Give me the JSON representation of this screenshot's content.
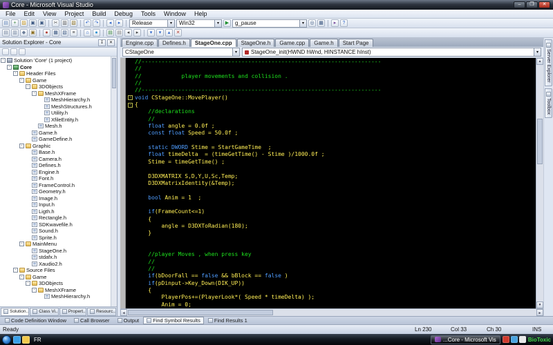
{
  "window": {
    "title": "Core - Microsoft Visual Studio",
    "buttons": {
      "minimize": "–",
      "maximize": "❐",
      "close": "✕"
    }
  },
  "glyphs": {
    "chevron": "▾",
    "up": "▲",
    "down": "▼",
    "left": "◄",
    "right": "►",
    "pin": "↧",
    "close_small": "✕"
  },
  "colors": {
    "comment": "#1ee11e",
    "keyword": "#4f9dff",
    "code_text": "#ffee55",
    "editor_bg": "#000000",
    "tray_green": "#46d94a"
  },
  "menu_bar": {
    "items": [
      "File",
      "Edit",
      "View",
      "Project",
      "Build",
      "Debug",
      "Tools",
      "Window",
      "Help"
    ]
  },
  "toolbar_main": {
    "icons_left": [
      {
        "name": "new-project-icon",
        "glyph": "▤",
        "color": "#5b7fb5"
      },
      {
        "name": "add-item-icon",
        "glyph": "+",
        "color": "#2e7d32"
      },
      {
        "name": "open-file-icon",
        "glyph": "▨",
        "color": "#c9971f"
      },
      {
        "name": "save-icon",
        "glyph": "▣",
        "color": "#35527e"
      },
      {
        "name": "save-all-icon",
        "glyph": "▣",
        "color": "#35527e",
        "sep": true
      },
      {
        "name": "cut-icon",
        "glyph": "✂",
        "color": "#555555"
      },
      {
        "name": "copy-icon",
        "glyph": "▥",
        "color": "#555555"
      },
      {
        "name": "paste-icon",
        "glyph": "▧",
        "color": "#8a6d1d",
        "sep": true
      },
      {
        "name": "undo-icon",
        "glyph": "↶",
        "color": "#2a62c9"
      },
      {
        "name": "redo-icon",
        "glyph": "↷",
        "color": "#2a62c9",
        "sep": true
      },
      {
        "name": "navigate-backward-icon",
        "glyph": "◂",
        "color": "#2a62c9"
      },
      {
        "name": "navigate-forward-icon",
        "glyph": "▸",
        "color": "#2a62c9",
        "sep": true
      }
    ],
    "config_combo": {
      "value": "Release"
    },
    "platform_combo": {
      "value": "Win32"
    },
    "start_debug_icon": {
      "name": "start-debug-icon",
      "glyph": "▶",
      "color": "#1e8f2e"
    },
    "find_combo": {
      "value": "g_pause"
    },
    "icons_right": [
      {
        "name": "find-icon",
        "glyph": "◎",
        "color": "#35527e"
      },
      {
        "name": "find-in-files-icon",
        "glyph": "▦",
        "color": "#35527e",
        "sep": true
      },
      {
        "name": "macro-icon",
        "glyph": "▸",
        "color": "#7a4a9e"
      },
      {
        "name": "help-icon",
        "glyph": "?",
        "color": "#2a62c9"
      }
    ]
  },
  "toolbar_secondary": {
    "icons": [
      {
        "name": "solution-explorer-toggle-icon",
        "glyph": "▤",
        "color": "#6b7d99"
      },
      {
        "name": "properties-window-icon",
        "glyph": "▥",
        "color": "#6b7d99"
      },
      {
        "name": "object-browser-icon",
        "glyph": "◆",
        "color": "#6b7d99"
      },
      {
        "name": "toolbox-toggle-icon",
        "glyph": "▣",
        "color": "#8a6d1d",
        "sep": true
      },
      {
        "name": "error-list-icon",
        "glyph": "●",
        "color": "#b23a2e"
      },
      {
        "name": "output-window-icon",
        "glyph": "▦",
        "color": "#35527e"
      },
      {
        "name": "immediate-window-icon",
        "glyph": "▧",
        "color": "#35527e"
      },
      {
        "name": "command-window-icon",
        "glyph": "≡",
        "color": "#444444",
        "sep": true
      },
      {
        "name": "start-page-icon",
        "glyph": "⌂",
        "color": "#2a62c9"
      },
      {
        "name": "web-browser-icon",
        "glyph": "●",
        "color": "#2a8fd0",
        "sep": true
      },
      {
        "name": "comment-selection-icon",
        "glyph": "▤",
        "color": "#2e7d32"
      },
      {
        "name": "uncomment-selection-icon",
        "glyph": "▤",
        "color": "#777777"
      },
      {
        "name": "decrease-indent-icon",
        "glyph": "◂",
        "color": "#444444"
      },
      {
        "name": "increase-indent-icon",
        "glyph": "▸",
        "color": "#444444",
        "sep": true
      },
      {
        "name": "bookmark-icon",
        "glyph": "▾",
        "color": "#2a62c9"
      },
      {
        "name": "next-bookmark-icon",
        "glyph": "▾",
        "color": "#2a62c9"
      },
      {
        "name": "previous-bookmark-icon",
        "glyph": "▴",
        "color": "#2a62c9"
      },
      {
        "name": "clear-bookmarks-icon",
        "glyph": "✕",
        "color": "#b23a2e"
      }
    ]
  },
  "solution_explorer": {
    "title": "Solution Explorer - Core",
    "toolbar_icons": [
      "properties-icon",
      "show-all-files-icon",
      "refresh-icon"
    ],
    "tree": [
      {
        "label": "Solution 'Core' (1 project)",
        "level": 0,
        "type": "solution",
        "expand": "-"
      },
      {
        "label": "Core",
        "level": 1,
        "type": "project",
        "expand": "-",
        "bold": true
      },
      {
        "label": "Header Files",
        "level": 2,
        "type": "folder",
        "expand": "-"
      },
      {
        "label": "Game",
        "level": 3,
        "type": "folder",
        "expand": "-"
      },
      {
        "label": "3DObjects",
        "level": 4,
        "type": "folder",
        "expand": "-"
      },
      {
        "label": "MeshXFrame",
        "level": 5,
        "type": "folder",
        "expand": "-"
      },
      {
        "label": "MeshHierarchy.h",
        "level": 6,
        "type": "file"
      },
      {
        "label": "MeshStructures.h",
        "level": 6,
        "type": "file"
      },
      {
        "label": "Utility.h",
        "level": 6,
        "type": "file"
      },
      {
        "label": "XfileEntity.h",
        "level": 6,
        "type": "file"
      },
      {
        "label": "Mesh.h",
        "level": 5,
        "type": "file"
      },
      {
        "label": "Game.h",
        "level": 4,
        "type": "file"
      },
      {
        "label": "GameDefine.h",
        "level": 4,
        "type": "file"
      },
      {
        "label": "Graphic",
        "level": 3,
        "type": "folder",
        "expand": "-"
      },
      {
        "label": "Base.h",
        "level": 4,
        "type": "file"
      },
      {
        "label": "Camera.h",
        "level": 4,
        "type": "file"
      },
      {
        "label": "Defines.h",
        "level": 4,
        "type": "file"
      },
      {
        "label": "Engine.h",
        "level": 4,
        "type": "file"
      },
      {
        "label": "Font.h",
        "level": 4,
        "type": "file"
      },
      {
        "label": "FrameControl.h",
        "level": 4,
        "type": "file"
      },
      {
        "label": "Geometry.h",
        "level": 4,
        "type": "file"
      },
      {
        "label": "Image.h",
        "level": 4,
        "type": "file"
      },
      {
        "label": "Input.h",
        "level": 4,
        "type": "file"
      },
      {
        "label": "Ligth.h",
        "level": 4,
        "type": "file"
      },
      {
        "label": "Rectangle.h",
        "level": 4,
        "type": "file"
      },
      {
        "label": "SDKwavefile.h",
        "level": 4,
        "type": "file"
      },
      {
        "label": "Sound.h",
        "level": 4,
        "type": "file"
      },
      {
        "label": "Sprite.h",
        "level": 4,
        "type": "file"
      },
      {
        "label": "MainMenu",
        "level": 3,
        "type": "folder",
        "expand": "-"
      },
      {
        "label": "StageOne.h",
        "level": 4,
        "type": "file"
      },
      {
        "label": "stdafx.h",
        "level": 4,
        "type": "file"
      },
      {
        "label": "Xaudio2.h",
        "level": 4,
        "type": "file"
      },
      {
        "label": "Source Files",
        "level": 2,
        "type": "folder",
        "expand": "-"
      },
      {
        "label": "Game",
        "level": 3,
        "type": "folder",
        "expand": "-"
      },
      {
        "label": "3DObjects",
        "level": 4,
        "type": "folder",
        "expand": "-"
      },
      {
        "label": "MeshXFrame",
        "level": 5,
        "type": "folder",
        "expand": "-"
      },
      {
        "label": "MeshHierarchy.h",
        "level": 6,
        "type": "file"
      }
    ],
    "bottom_tabs": [
      {
        "label": "Solution...",
        "icon": "solution-explorer-tab-icon",
        "active": true
      },
      {
        "label": "Class Vi...",
        "icon": "class-view-tab-icon"
      },
      {
        "label": "Propert...",
        "icon": "properties-tab-icon"
      },
      {
        "label": "Resourc...",
        "icon": "resource-view-tab-icon"
      }
    ]
  },
  "editor": {
    "tabs": [
      {
        "label": "Engine.cpp"
      },
      {
        "label": "Defines.h"
      },
      {
        "label": "StageOne.cpp",
        "active": true
      },
      {
        "label": "StageOne.h"
      },
      {
        "label": "Game.cpp"
      },
      {
        "label": "Game.h"
      },
      {
        "label": "Start Page"
      }
    ],
    "scope_combo": "CStageOne",
    "member_combo": "StageOne_init(HWND hWnd, HINSTANCE hInst)",
    "code": [
      {
        "segs": [
          [
            "c",
            "//------------------------------------------------------------------------"
          ]
        ]
      },
      {
        "segs": [
          [
            "c",
            "//"
          ]
        ]
      },
      {
        "segs": [
          [
            "c",
            "//            player movements and collision ."
          ]
        ]
      },
      {
        "segs": [
          [
            "c",
            "//"
          ]
        ]
      },
      {
        "segs": [
          [
            "c",
            "//------------------------------------------------------------------------"
          ]
        ]
      },
      {
        "fold": "-",
        "segs": [
          [
            "k",
            "void"
          ],
          [
            "t",
            " CStageOne::MovePlayer()"
          ]
        ]
      },
      {
        "fold": "-",
        "segs": [
          [
            "t",
            "{"
          ]
        ]
      },
      {
        "segs": [
          [
            "c",
            "    //declarations"
          ]
        ]
      },
      {
        "segs": [
          [
            "c",
            "    //"
          ]
        ]
      },
      {
        "segs": [
          [
            "t",
            "    "
          ],
          [
            "k",
            "float"
          ],
          [
            "t",
            " angle = 0.0f ;"
          ]
        ]
      },
      {
        "segs": [
          [
            "t",
            "    "
          ],
          [
            "k",
            "const"
          ],
          [
            "t",
            " "
          ],
          [
            "k",
            "float"
          ],
          [
            "t",
            " Speed = 50.0f ;"
          ]
        ]
      },
      {
        "segs": []
      },
      {
        "segs": [
          [
            "t",
            "    "
          ],
          [
            "k",
            "static"
          ],
          [
            "t",
            " "
          ],
          [
            "k",
            "DWORD"
          ],
          [
            "t",
            " Stime = StartGameTime  ;"
          ]
        ]
      },
      {
        "segs": [
          [
            "t",
            "    "
          ],
          [
            "k",
            "float"
          ],
          [
            "t",
            " timeDelta  = (timeGetTime() - Stime )/1000.0f ;"
          ]
        ]
      },
      {
        "segs": [
          [
            "t",
            "    Stime = timeGetTime() ;"
          ]
        ]
      },
      {
        "segs": []
      },
      {
        "segs": [
          [
            "t",
            "    D3DXMATRIX S,D,Y,U,Sc,Temp;"
          ]
        ]
      },
      {
        "segs": [
          [
            "t",
            "    D3DXMatrixIdentity(&Temp);"
          ]
        ]
      },
      {
        "segs": []
      },
      {
        "segs": [
          [
            "t",
            "    "
          ],
          [
            "k",
            "bool"
          ],
          [
            "t",
            " Anim = 1  ;"
          ]
        ]
      },
      {
        "segs": []
      },
      {
        "segs": [
          [
            "t",
            "    "
          ],
          [
            "k",
            "if"
          ],
          [
            "t",
            "(FrameCount<=1)"
          ]
        ]
      },
      {
        "segs": [
          [
            "t",
            "    {"
          ]
        ]
      },
      {
        "segs": [
          [
            "t",
            "        angle = D3DXToRadian(180);"
          ]
        ]
      },
      {
        "segs": [
          [
            "t",
            "    }"
          ]
        ]
      },
      {
        "segs": []
      },
      {
        "segs": []
      },
      {
        "segs": [
          [
            "c",
            "    //player Moves , when press key"
          ]
        ]
      },
      {
        "segs": [
          [
            "c",
            "    //"
          ]
        ]
      },
      {
        "segs": [
          [
            "c",
            "    //"
          ]
        ]
      },
      {
        "segs": [
          [
            "t",
            "    "
          ],
          [
            "k",
            "if"
          ],
          [
            "t",
            "(bDoorFall == "
          ],
          [
            "k",
            "false"
          ],
          [
            "t",
            " && bBlock == "
          ],
          [
            "k",
            "false"
          ],
          [
            "t",
            " )"
          ]
        ]
      },
      {
        "segs": [
          [
            "t",
            "    "
          ],
          [
            "k",
            "if"
          ],
          [
            "t",
            "(pDinput->Key_Down(DIK_UP))"
          ]
        ]
      },
      {
        "segs": [
          [
            "t",
            "    {"
          ]
        ]
      },
      {
        "segs": [
          [
            "t",
            "        PlayerPos+=(PlayerLook*( Speed * timeDelta) );"
          ]
        ]
      },
      {
        "segs": [
          [
            "t",
            "        Anim = 0;"
          ]
        ]
      }
    ]
  },
  "side_tabs": [
    {
      "label": "Server Explorer",
      "icon": "server-explorer-icon"
    },
    {
      "label": "Toolbox",
      "icon": "toolbox-icon"
    }
  ],
  "panel_tabs": [
    {
      "label": "Code Definition Window",
      "icon": "code-definition-icon"
    },
    {
      "label": "Call Browser",
      "icon": "call-browser-icon"
    },
    {
      "label": "Output",
      "icon": "output-icon"
    },
    {
      "label": "Find Symbol Results",
      "icon": "find-symbol-results-icon",
      "active": true
    },
    {
      "label": "Find Results 1",
      "icon": "find-results-icon"
    }
  ],
  "status_bar": {
    "message": "Ready",
    "line": "Ln 230",
    "column": "Col 33",
    "character": "Ch 30",
    "mode": "INS"
  },
  "taskbar": {
    "language": "FR",
    "quick_launch": [
      {
        "name": "ie-icon",
        "color": "#3aa0e8"
      },
      {
        "name": "explorer-icon",
        "color": "#f2c94c"
      }
    ],
    "task_button": {
      "label": "...Core - Microsoft Vis"
    },
    "tray_icons": [
      {
        "name": "tray-antivirus-icon",
        "color": "#d03a2e"
      },
      {
        "name": "tray-network-icon",
        "color": "#4aa3e0"
      },
      {
        "name": "tray-volume-icon",
        "color": "#e8e8e8"
      }
    ],
    "tray_label": "BioToxic"
  }
}
